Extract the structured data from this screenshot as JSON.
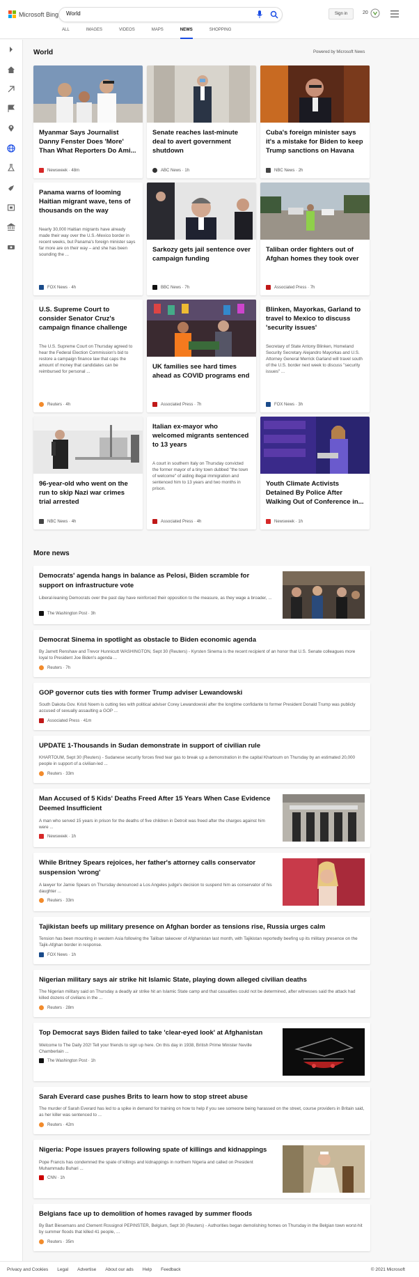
{
  "header": {
    "logo_text": "Microsoft Bing",
    "search_value": "World",
    "signin_label": "Sign in",
    "points": "20",
    "tabs": [
      "ALL",
      "IMAGES",
      "VIDEOS",
      "MAPS",
      "NEWS",
      "SHOPPING"
    ],
    "active_tab": "NEWS"
  },
  "section": {
    "title": "World",
    "powered": "Powered by Microsoft News"
  },
  "cards": [
    {
      "title": "Myanmar Says Journalist Danny Fenster Does 'More' Than What Reporters Do Ami...",
      "source": "Newsweek",
      "time": "48m"
    },
    {
      "title": "Senate reaches last-minute deal to avert government shutdown",
      "source": "ABC News",
      "time": "1h"
    },
    {
      "title": "Cuba's foreign minister says it's a mistake for Biden to keep Trump sanctions on Havana",
      "source": "NBC News",
      "time": "2h"
    },
    {
      "title": "Panama warns of looming Haitian migrant wave, tens of thousands on the way",
      "text": "Nearly 30,000 Haitian migrants have already made their way over the U.S.-Mexico border in recent weeks, but Panama's foreign minister says far more are on their way – and she has been sounding the ...",
      "source": "FOX News",
      "time": "4h"
    },
    {
      "title": "Sarkozy gets jail sentence over campaign funding",
      "source": "BBC News",
      "time": "7h"
    },
    {
      "title": "Taliban order fighters out of Afghan homes they took over",
      "source": "Associated Press",
      "time": "7h"
    },
    {
      "title": "U.S. Supreme Court to consider Senator Cruz's campaign finance challenge",
      "text": "The U.S. Supreme Court on Thursday agreed to hear the Federal Election Commission's bid to restore a campaign finance law that caps the amount of money that candidates can be reimbursed for personal ...",
      "source": "Reuters",
      "time": "4h"
    },
    {
      "title": "UK families see hard times ahead as COVID programs end",
      "source": "Associated Press",
      "time": "7h"
    },
    {
      "title": "Blinken, Mayorkas, Garland to travel to Mexico to discuss 'security issues'",
      "text": "Secretary of State Antony Blinken, Homeland Security Secretary Alejandro Mayorkas and U.S. Attorney General Merrick Garland will travel south of the U.S. border next week to discuss \"security issues\" ...",
      "source": "FOX News",
      "time": "3h"
    },
    {
      "title": "96-year-old who went on the run to skip Nazi war crimes trial arrested",
      "source": "NBC News",
      "time": "4h"
    },
    {
      "title": "Italian ex-mayor who welcomed migrants sentenced to 13 years",
      "text": "A court in southern Italy on Thursday convicted the former mayor of a tiny town dubbed \"the town of welcome\" of aiding illegal immigration and sentenced him to 13 years and two months in prison.",
      "source": "Associated Press",
      "time": "4h"
    },
    {
      "title": "Youth Climate Activists Detained By Police After Walking Out of Conference in...",
      "source": "Newsweek",
      "time": "1h"
    }
  ],
  "more_news_title": "More news",
  "more_news": [
    {
      "title": "Democrats' agenda hangs in balance as Pelosi, Biden scramble for support on infrastructure vote",
      "text": "Liberal-leaning Democrats over the past day have reinforced their opposition to the measure, as they wage a broader, ...",
      "source": "The Washington Post",
      "time": "3h"
    },
    {
      "title": "Democrat Sinema in spotlight as obstacle to Biden economic agenda",
      "text": "By Jarrett Renshaw and Trevor Hunnicutt WASHINGTON, Sept 30 (Reuters) - Kyrsten Sinema is the recent recipient of an honor that U.S. Senate colleagues more loyal to President Joe Biden's agenda ...",
      "source": "Reuters",
      "time": "7h"
    },
    {
      "title": "GOP governor cuts ties with former Trump adviser Lewandowski",
      "text": "South Dakota Gov. Kristi Noem is cutting ties with political adviser Corey Lewandowski after the longtime confidante to former President Donald Trump was publicly accused of sexually assaulting a GOP ...",
      "source": "Associated Press",
      "time": "41m"
    },
    {
      "title": "UPDATE 1-Thousands in Sudan demonstrate in support of civilian rule",
      "text": "KHARTOUM, Sept 30 (Reuters) - Sudanese security forces fired tear gas to break up a demonstration in the capital Khartoum on Thursday by an estimated 20,000 people in support of a civilian-led ...",
      "source": "Reuters",
      "time": "33m"
    },
    {
      "title": "Man Accused of 5 Kids' Deaths Freed After 15 Years When Case Evidence Deemed Insufficient",
      "text": "A man who served 15 years in prison for the deaths of five children in Detroit was freed after the charges against him were ...",
      "source": "Newsweek",
      "time": "1h"
    },
    {
      "title": "While Britney Spears rejoices, her father's attorney calls conservator suspension 'wrong'",
      "text": "A lawyer for Jamie Spears on Thursday denounced a Los Angeles judge's decision to suspend him as conservator of his daughter ...",
      "source": "Reuters",
      "time": "33m"
    },
    {
      "title": "Tajikistan beefs up military presence on Afghan border as tensions rise, Russia urges calm",
      "text": "Tension has been mounting in western Asia following the Taliban takeover of Afghanistan last month, with Tajikistan reportedly beefing up its military presence on the Tajik-Afghan border in response.",
      "source": "FOX News",
      "time": "1h"
    },
    {
      "title": "Nigerian military says air strike hit Islamic State, playing down alleged civilian deaths",
      "text": "The Nigerian military said on Thursday a deadly air strike hit an Islamic State camp and that casualties could not be determined, after witnesses said the attack had killed dozens of civilians in the ...",
      "source": "Reuters",
      "time": "28m"
    },
    {
      "title": "Top Democrat says Biden failed to take 'clear-eyed look' at Afghanistan",
      "text": "Welcome to The Daily 202! Tell your friends to sign up here. On this day in 1938, British Prime Minister Neville Chamberlain ...",
      "source": "The Washington Post",
      "time": "1h"
    },
    {
      "title": "Sarah Everard case pushes Brits to learn how to stop street abuse",
      "text": "The murder of Sarah Everard has led to a spike in demand for training on how to help if you see someone being harassed on the street, course providers in Britain said, as her killer was sentenced to ...",
      "source": "Reuters",
      "time": "42m"
    },
    {
      "title": "Nigeria: Pope issues prayers following spate of killings and kidnappings",
      "text": "Pope Francis has condemned the spate of killings and kidnappings in northern Nigeria and called on President Muhammadu Buhari ...",
      "source": "CNN",
      "time": "1h"
    },
    {
      "title": "Belgians face up to demolition of homes ravaged by summer floods",
      "text": "By Bart Biesemans and Clement Rossignol PEPINSTER, Belgium, Sept 30 (Reuters) - Authorities began demolishing homes on Thursday in the Belgian town worst-hit by summer floods that killed 41 people, ...",
      "source": "Reuters",
      "time": "35m"
    }
  ],
  "footer": {
    "links": [
      "Privacy and Cookies",
      "Legal",
      "Advertise",
      "About our ads",
      "Help",
      "Feedback"
    ],
    "copyright": "© 2021 Microsoft"
  }
}
